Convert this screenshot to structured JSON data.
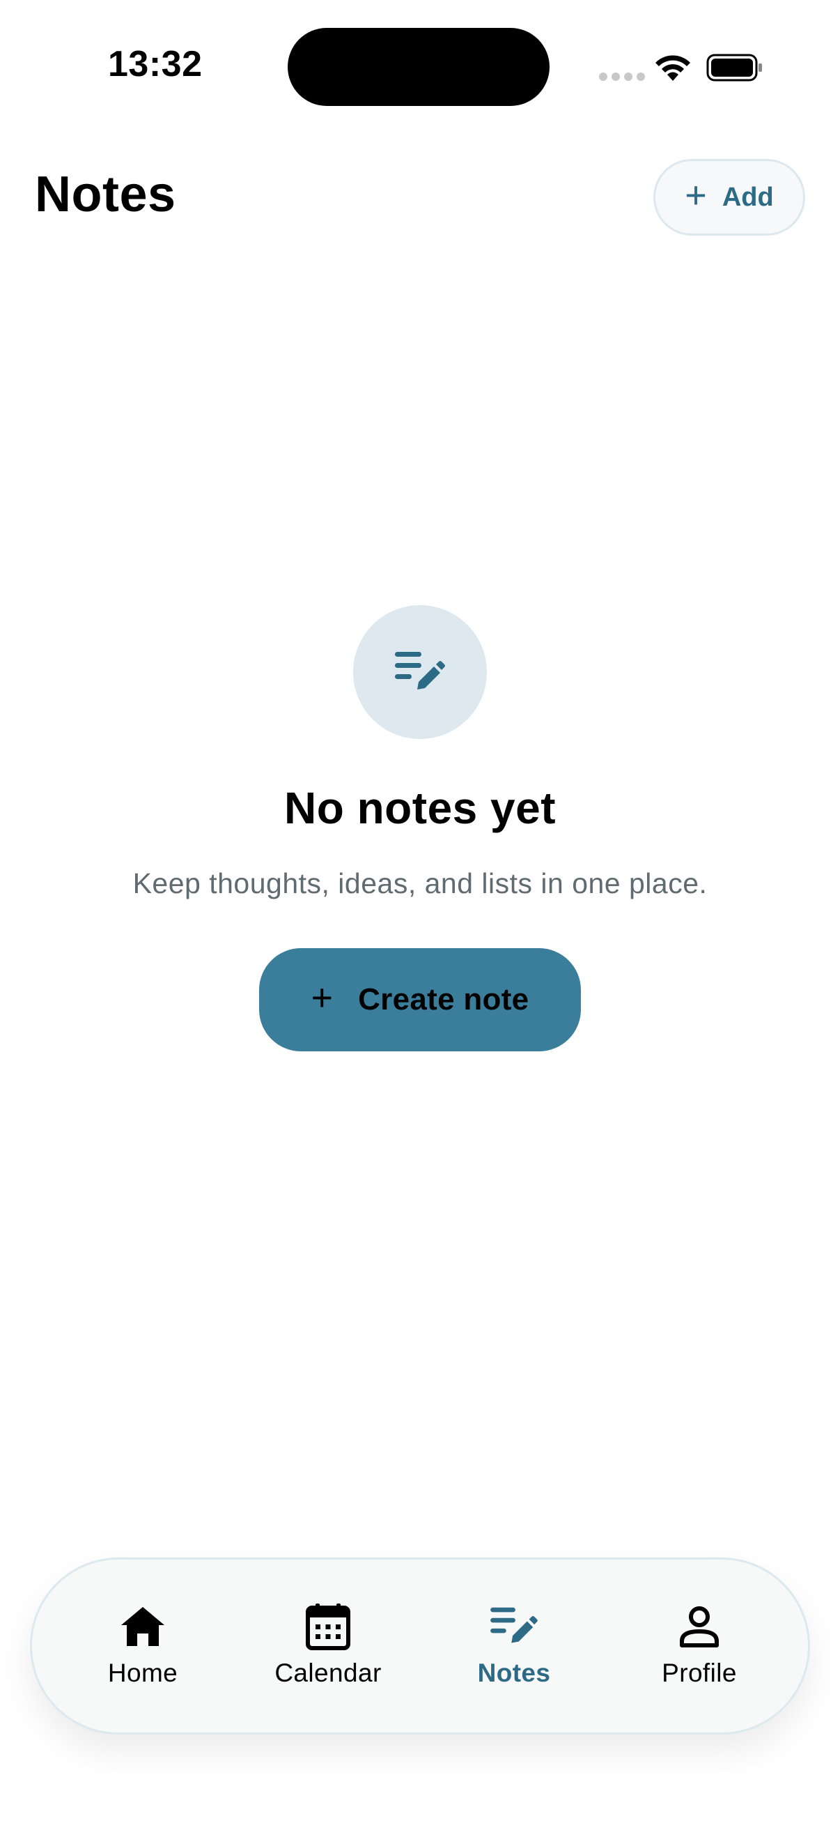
{
  "status_bar": {
    "time": "13:32"
  },
  "header": {
    "title": "Notes",
    "add_label": "Add"
  },
  "empty_state": {
    "title": "No notes yet",
    "subtitle": "Keep thoughts, ideas, and lists in one place.",
    "create_label": "Create note"
  },
  "tabbar": {
    "items": [
      {
        "label": "Home",
        "icon": "home-icon",
        "active": false
      },
      {
        "label": "Calendar",
        "icon": "calendar-icon",
        "active": false
      },
      {
        "label": "Notes",
        "icon": "notes-edit-icon",
        "active": true
      },
      {
        "label": "Profile",
        "icon": "person-icon",
        "active": false
      }
    ]
  },
  "colors": {
    "accent": "#3a7e9b",
    "accent_dark": "#2c6a86",
    "icon_circle": "#dde9ef"
  }
}
